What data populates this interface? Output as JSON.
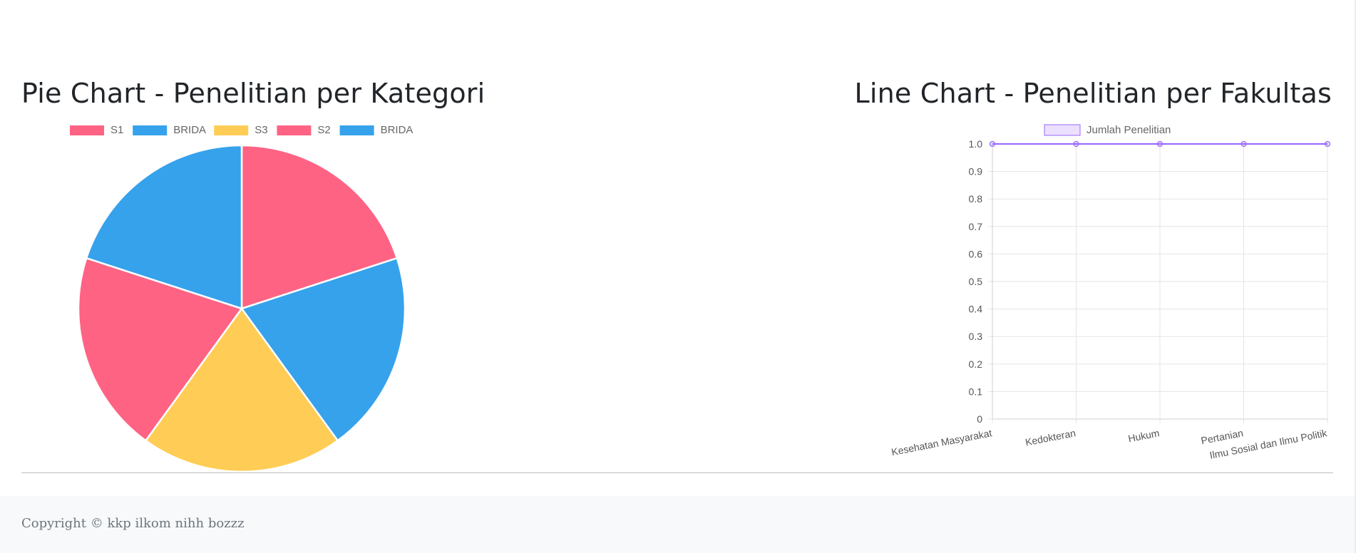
{
  "pie_section": {
    "title": "Pie Chart - Penelitian per Kategori"
  },
  "line_section": {
    "title": "Line Chart - Penelitian per Fakultas"
  },
  "footer": {
    "copyright": "Copyright © kkp ilkom nihh bozzz"
  },
  "chart_data": [
    {
      "type": "pie",
      "title": "Pie Chart - Penelitian per Kategori",
      "categories": [
        "S1",
        "BRIDA",
        "S3",
        "S2",
        "BRIDA"
      ],
      "values": [
        1,
        1,
        1,
        1,
        1
      ],
      "colors": [
        "#ff6384",
        "#36a2eb",
        "#ffcd56",
        "#ff6384",
        "#36a2eb"
      ],
      "legend": "top"
    },
    {
      "type": "line",
      "title": "Line Chart - Penelitian per Fakultas",
      "categories": [
        "Kesehatan Masyarakat",
        "Kedokteran",
        "Hukum",
        "Pertanian",
        "Ilmu Sosial dan Ilmu Politik"
      ],
      "series": [
        {
          "name": "Jumlah Penelitian",
          "values": [
            1,
            1,
            1,
            1,
            1
          ],
          "color": "#9966ff"
        }
      ],
      "ylim": [
        0,
        1
      ],
      "yticks": [
        "0",
        "0.1",
        "0.2",
        "0.3",
        "0.4",
        "0.5",
        "0.6",
        "0.7",
        "0.8",
        "0.9",
        "1.0"
      ],
      "grid": true,
      "legend": "top"
    }
  ]
}
